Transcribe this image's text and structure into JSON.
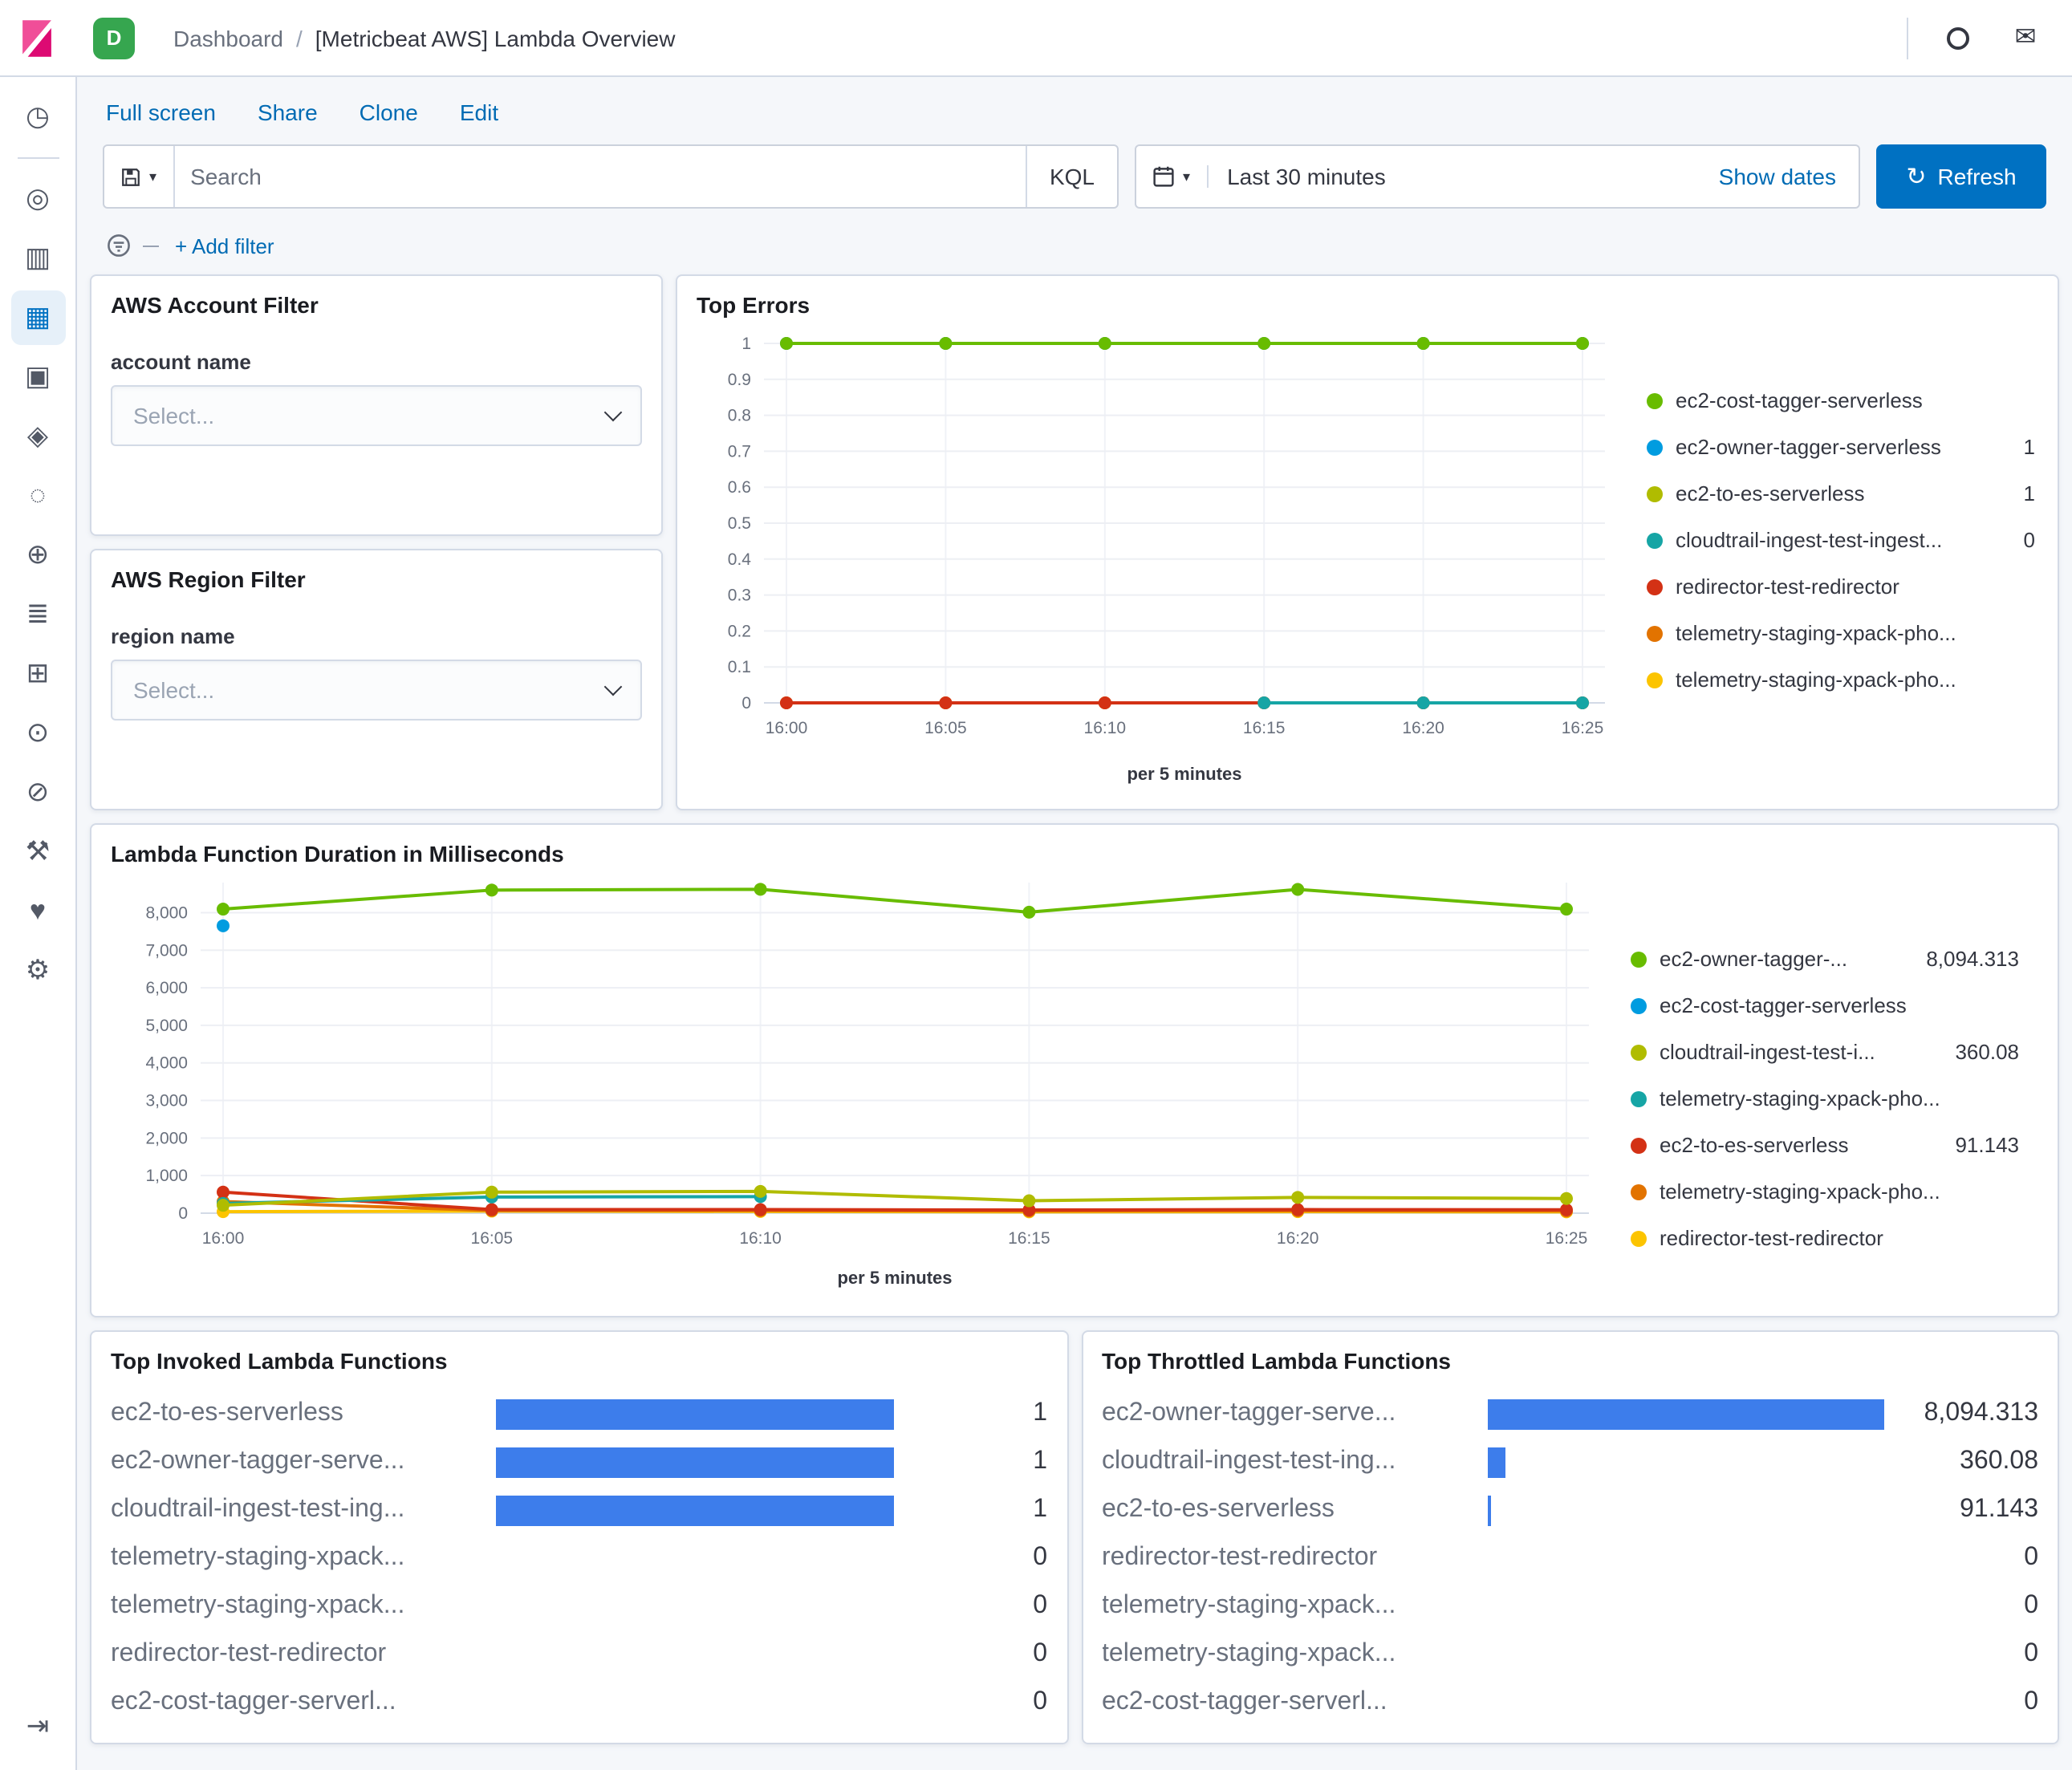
{
  "colors": {
    "accent_blue": "#006BB4",
    "primary_button": "#0071C2",
    "bar_blue": "#3D7DEB",
    "panel_border": "#D3DAE6",
    "page_bg": "#F5F7FA",
    "series_palette": [
      "#68BC00",
      "#009CE0",
      "#B0BC00",
      "#16A5A5",
      "#D33115",
      "#E27300",
      "#FCC400"
    ]
  },
  "header": {
    "space_badge": "D",
    "breadcrumb": {
      "app": "Dashboard",
      "separator": "/",
      "page": "[Metricbeat AWS] Lambda Overview"
    }
  },
  "sidebar": {
    "items": [
      {
        "name": "recently-viewed",
        "icon": "clock-icon",
        "glyph": "◷"
      },
      {
        "name": "discover",
        "icon": "discover-icon",
        "glyph": "◎"
      },
      {
        "name": "visualize",
        "icon": "visualize-icon",
        "glyph": "▥"
      },
      {
        "name": "dashboard",
        "icon": "dashboard-icon",
        "glyph": "▦",
        "active": true
      },
      {
        "name": "canvas",
        "icon": "canvas-icon",
        "glyph": "▣"
      },
      {
        "name": "maps",
        "icon": "maps-icon",
        "glyph": "◈"
      },
      {
        "name": "machine-learning",
        "icon": "machine-learning-icon",
        "glyph": "◌"
      },
      {
        "name": "graph",
        "icon": "graph-icon",
        "glyph": "⊕"
      },
      {
        "name": "logs",
        "icon": "logs-icon",
        "glyph": "≣"
      },
      {
        "name": "ingest",
        "icon": "ingest-icon",
        "glyph": "⊞"
      },
      {
        "name": "uptime",
        "icon": "uptime-icon",
        "glyph": "⊙"
      },
      {
        "name": "security",
        "icon": "lock-icon",
        "glyph": "⊘"
      },
      {
        "name": "dev-tools",
        "icon": "wrench-icon",
        "glyph": "⚒"
      },
      {
        "name": "stack-monitoring",
        "icon": "heartbeat-icon",
        "glyph": "♥"
      },
      {
        "name": "management",
        "icon": "gear-icon",
        "glyph": "⚙"
      }
    ],
    "collapse_glyph": "⇥"
  },
  "toolbar": {
    "links": [
      {
        "label": "Full screen"
      },
      {
        "label": "Share"
      },
      {
        "label": "Clone"
      },
      {
        "label": "Edit"
      }
    ]
  },
  "search": {
    "placeholder": "Search",
    "kql_label": "KQL",
    "time_range": "Last 30 minutes",
    "show_dates_label": "Show dates",
    "refresh_label": "Refresh"
  },
  "filter_bar": {
    "add_filter_label": "+ Add filter"
  },
  "panels": {
    "account_filter": {
      "title": "AWS Account Filter",
      "field_label": "account name",
      "select_placeholder": "Select..."
    },
    "region_filter": {
      "title": "AWS Region Filter",
      "field_label": "region name",
      "select_placeholder": "Select..."
    },
    "top_errors": {
      "title": "Top Errors"
    },
    "duration": {
      "title": "Lambda Function Duration in Milliseconds"
    },
    "top_invoked": {
      "title": "Top Invoked Lambda Functions"
    },
    "top_throttled": {
      "title": "Top Throttled Lambda Functions"
    }
  },
  "chart_data": [
    {
      "id": "chart-errors",
      "type": "line",
      "title": "Top Errors",
      "x": [
        "16:00",
        "16:05",
        "16:10",
        "16:15",
        "16:20",
        "16:25"
      ],
      "xlabel": "per 5 minutes",
      "ylim": [
        0,
        1
      ],
      "yticks": [
        0,
        0.1,
        0.2,
        0.3,
        0.4,
        0.5,
        0.6,
        0.7,
        0.8,
        0.9,
        1
      ],
      "ytick_labels": [
        "0",
        "0.1",
        "0.2",
        "0.3",
        "0.4",
        "0.5",
        "0.6",
        "0.7",
        "0.8",
        "0.9",
        "1"
      ],
      "grid": true,
      "legend_position": "right",
      "series": [
        {
          "name": "ec2-cost-tagger-serverless",
          "color": "#68BC00",
          "legend_value": "",
          "values": [
            1,
            1,
            1,
            1,
            1,
            1
          ]
        },
        {
          "name": "ec2-owner-tagger-serverless",
          "color": "#009CE0",
          "legend_value": "1",
          "values": [
            1,
            1,
            1,
            1,
            1,
            1
          ]
        },
        {
          "name": "ec2-to-es-serverless",
          "color": "#B0BC00",
          "legend_value": "1",
          "values": [
            1,
            1,
            1,
            1,
            1,
            1
          ]
        },
        {
          "name": "cloudtrail-ingest-test-ingest...",
          "color": "#16A5A5",
          "legend_value": "0",
          "values": [
            null,
            null,
            null,
            0,
            0,
            0
          ]
        },
        {
          "name": "redirector-test-redirector",
          "color": "#D33115",
          "legend_value": "",
          "values": [
            0,
            0,
            0,
            0,
            0,
            0
          ]
        },
        {
          "name": "telemetry-staging-xpack-pho...",
          "color": "#E27300",
          "legend_value": "",
          "values": [
            0,
            0,
            0,
            0,
            0,
            0
          ]
        },
        {
          "name": "telemetry-staging-xpack-pho...",
          "color": "#FCC400",
          "legend_value": "",
          "values": [
            0,
            0,
            0,
            0,
            0,
            0
          ]
        }
      ]
    },
    {
      "id": "chart-duration",
      "type": "line",
      "title": "Lambda Function Duration in Milliseconds",
      "x": [
        "16:00",
        "16:05",
        "16:10",
        "16:15",
        "16:20",
        "16:25"
      ],
      "xlabel": "per 5 minutes",
      "ylim": [
        0,
        8800
      ],
      "yticks": [
        0,
        1000,
        2000,
        3000,
        4000,
        5000,
        6000,
        7000,
        8000
      ],
      "ytick_labels": [
        "0",
        "1,000",
        "2,000",
        "3,000",
        "4,000",
        "5,000",
        "6,000",
        "7,000",
        "8,000"
      ],
      "grid": true,
      "legend_position": "right",
      "series": [
        {
          "name": "ec2-owner-tagger-...",
          "color": "#68BC00",
          "legend_value": "8,094.313",
          "values": [
            8094.313,
            8601,
            8622,
            8012,
            8619,
            8094.313
          ]
        },
        {
          "name": "ec2-cost-tagger-serverless",
          "color": "#009CE0",
          "legend_value": "",
          "values": [
            7650,
            null,
            null,
            null,
            null,
            null
          ]
        },
        {
          "name": "cloudtrail-ingest-test-i...",
          "color": "#B0BC00",
          "legend_value": "360.08",
          "values": [
            210,
            560,
            580,
            330,
            420,
            390
          ]
        },
        {
          "name": "telemetry-staging-xpack-pho...",
          "color": "#16A5A5",
          "legend_value": "",
          "values": [
            260,
            430,
            440,
            null,
            null,
            null
          ]
        },
        {
          "name": "ec2-to-es-serverless",
          "color": "#D33115",
          "legend_value": "91.143",
          "values": [
            560,
            95,
            95,
            85,
            95,
            91.143
          ]
        },
        {
          "name": "telemetry-staging-xpack-pho...",
          "color": "#E27300",
          "legend_value": "",
          "values": [
            310,
            70,
            70,
            60,
            65,
            60
          ]
        },
        {
          "name": "redirector-test-redirector",
          "color": "#FCC400",
          "legend_value": "",
          "values": [
            40,
            55,
            45,
            35,
            40,
            35
          ]
        }
      ]
    },
    {
      "id": "bars-invoked",
      "type": "bar",
      "orientation": "horizontal",
      "title": "Top Invoked Lambda Functions",
      "max": 1,
      "bar_color": "#3D7DEB",
      "rows": [
        {
          "label": "ec2-to-es-serverless",
          "value": 1,
          "display": "1"
        },
        {
          "label": "ec2-owner-tagger-serve...",
          "value": 1,
          "display": "1"
        },
        {
          "label": "cloudtrail-ingest-test-ing...",
          "value": 1,
          "display": "1"
        },
        {
          "label": "telemetry-staging-xpack...",
          "value": 0,
          "display": "0"
        },
        {
          "label": "telemetry-staging-xpack...",
          "value": 0,
          "display": "0"
        },
        {
          "label": "redirector-test-redirector",
          "value": 0,
          "display": "0"
        },
        {
          "label": "ec2-cost-tagger-serverl...",
          "value": 0,
          "display": "0"
        }
      ]
    },
    {
      "id": "bars-throttled",
      "type": "bar",
      "orientation": "horizontal",
      "title": "Top Throttled Lambda Functions",
      "max": 8094.313,
      "bar_color": "#3D7DEB",
      "rows": [
        {
          "label": "ec2-owner-tagger-serve...",
          "value": 8094.313,
          "display": "8,094.313"
        },
        {
          "label": "cloudtrail-ingest-test-ing...",
          "value": 360.08,
          "display": "360.08"
        },
        {
          "label": "ec2-to-es-serverless",
          "value": 91.143,
          "display": "91.143"
        },
        {
          "label": "redirector-test-redirector",
          "value": 0,
          "display": "0"
        },
        {
          "label": "telemetry-staging-xpack...",
          "value": 0,
          "display": "0"
        },
        {
          "label": "telemetry-staging-xpack...",
          "value": 0,
          "display": "0"
        },
        {
          "label": "ec2-cost-tagger-serverl...",
          "value": 0,
          "display": "0"
        }
      ]
    }
  ]
}
